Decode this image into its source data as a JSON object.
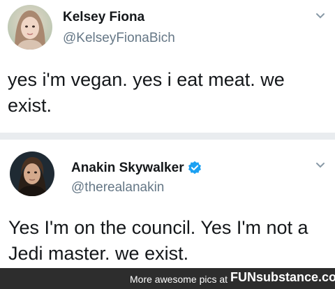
{
  "tweets": [
    {
      "name": "Kelsey Fiona",
      "handle": "@KelseyFionaBich",
      "text": "yes i'm vegan. yes i eat meat. we exist.",
      "verified": false,
      "avatar_icon": "woman-portrait-avatar"
    },
    {
      "name": "Anakin Skywalker",
      "handle": "@therealanakin",
      "text": "Yes I'm on the council. Yes I'm not a Jedi master. we exist.",
      "verified": true,
      "avatar_icon": "man-portrait-avatar"
    }
  ],
  "footer": {
    "prefix": "More awesome pics at",
    "brand": "FUNsubstance.com"
  },
  "colors": {
    "name": "#14171a",
    "handle": "#657786",
    "verified": "#1da1f2",
    "separator": "#e9ecef",
    "footer_bg": "#2d2d2d",
    "brand_accent": "#ffcc00"
  },
  "icons": {
    "dropdown": "chevron-down-icon",
    "verified": "verified-badge-icon"
  }
}
